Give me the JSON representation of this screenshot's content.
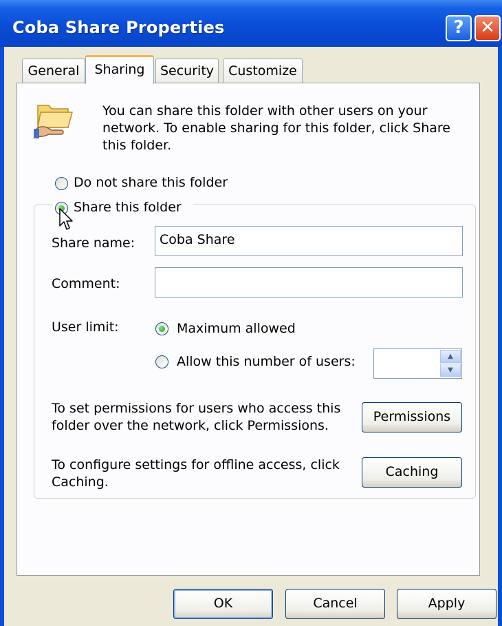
{
  "window": {
    "title": "Coba Share Properties",
    "help_glyph": "?",
    "close_glyph": "✕"
  },
  "tabs": [
    {
      "label": "General"
    },
    {
      "label": "Sharing"
    },
    {
      "label": "Security"
    },
    {
      "label": "Customize"
    }
  ],
  "sharing": {
    "info": "You can share this folder with other users on your network.  To enable sharing for this folder, click Share this folder.",
    "folder_icon": "shared-folder-icon",
    "option_do_not_share": "Do not share this folder",
    "option_share": "Share this folder",
    "share_name_label": "Share name:",
    "share_name_value": "Coba Share",
    "comment_label": "Comment:",
    "comment_value": "",
    "user_limit_label": "User limit:",
    "user_limit_max": "Maximum allowed",
    "user_limit_allow": "Allow this number of users:",
    "user_limit_value": "",
    "permissions_text": "To set permissions for users who access this folder over the network, click Permissions.",
    "permissions_button": "Permissions",
    "caching_text": "To configure settings for offline access, click Caching.",
    "caching_button": "Caching"
  },
  "footer": {
    "ok": "OK",
    "cancel": "Cancel",
    "apply": "Apply"
  },
  "colors": {
    "titlebar": "#0a4cd6",
    "dialog_bg": "#ece9d8",
    "tab_highlight": "#f6b54a",
    "radio_dot": "#21a121"
  }
}
